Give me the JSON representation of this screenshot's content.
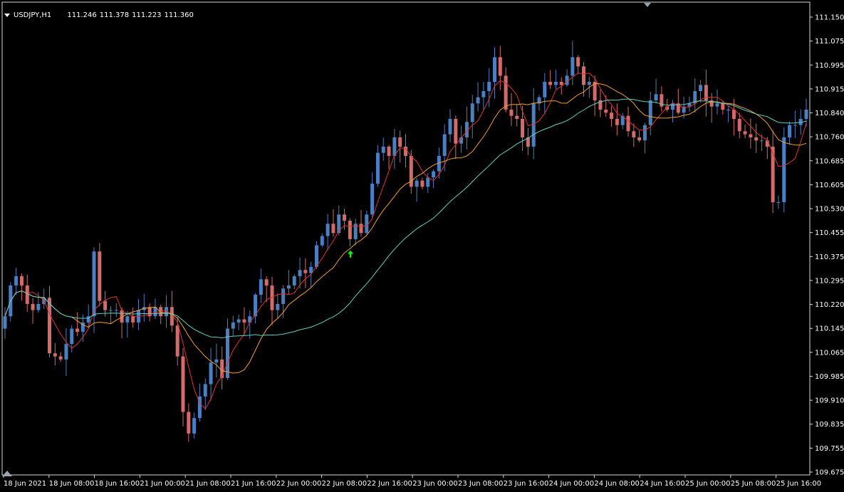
{
  "header": {
    "symbol": "USDJPY,H1",
    "open": "111.246",
    "high": "111.378",
    "low": "111.223",
    "close": "111.360"
  },
  "chart_data": {
    "type": "candlestick",
    "symbol": "USDJPY",
    "timeframe": "H1",
    "ylim": [
      109.675,
      111.2
    ],
    "y_ticks": [
      "111.150",
      "111.075",
      "110.995",
      "110.915",
      "110.840",
      "110.760",
      "110.685",
      "110.605",
      "110.530",
      "110.455",
      "110.375",
      "110.295",
      "110.220",
      "110.145",
      "110.065",
      "109.985",
      "109.910",
      "109.835",
      "109.755",
      "109.675"
    ],
    "x_ticks": [
      "18 Jun 2021",
      "18 Jun 08:00",
      "18 Jun 16:00",
      "21 Jun 00:00",
      "21 Jun 08:00",
      "21 Jun 16:00",
      "22 Jun 00:00",
      "22 Jun 08:00",
      "22 Jun 16:00",
      "23 Jun 00:00",
      "23 Jun 08:00",
      "23 Jun 16:00",
      "24 Jun 00:00",
      "24 Jun 08:00",
      "24 Jun 16:00",
      "25 Jun 00:00",
      "25 Jun 08:00",
      "25 Jun 16:00"
    ],
    "bull_color": "#4a7fc1",
    "bear_color": "#d46a6a",
    "candle_closes": [
      110.18,
      110.28,
      110.31,
      110.28,
      110.22,
      110.2,
      110.22,
      110.24,
      110.06,
      110.05,
      110.04,
      110.09,
      110.14,
      110.13,
      110.16,
      110.18,
      110.39,
      110.23,
      110.2,
      110.2,
      110.2,
      110.16,
      110.18,
      110.16,
      110.2,
      110.21,
      110.18,
      110.21,
      110.18,
      110.21,
      110.15,
      110.05,
      109.87,
      109.8,
      109.85,
      109.92,
      109.96,
      110.03,
      110.04,
      109.98,
      110.14,
      110.16,
      110.17,
      110.16,
      110.18,
      110.25,
      110.3,
      110.28,
      110.2,
      110.22,
      110.27,
      110.28,
      110.31,
      110.33,
      110.32,
      110.34,
      110.41,
      110.44,
      110.48,
      110.45,
      110.51,
      110.49,
      110.43,
      110.48,
      110.45,
      110.51,
      110.61,
      110.71,
      110.73,
      110.7,
      110.76,
      110.73,
      110.7,
      110.6,
      110.62,
      110.6,
      110.63,
      110.65,
      110.7,
      110.77,
      110.82,
      110.74,
      110.76,
      110.81,
      110.87,
      110.89,
      110.91,
      110.94,
      111.02,
      110.96,
      110.85,
      110.83,
      110.82,
      110.76,
      110.73,
      110.87,
      110.89,
      110.94,
      110.93,
      110.94,
      110.93,
      110.96,
      111.02,
      110.99,
      110.93,
      110.94,
      110.88,
      110.85,
      110.84,
      110.82,
      110.8,
      110.83,
      110.78,
      110.76,
      110.75,
      110.8,
      110.88,
      110.9,
      110.86,
      110.85,
      110.87,
      110.84,
      110.86,
      110.87,
      110.91,
      110.93,
      110.88,
      110.86,
      110.87,
      110.85,
      110.85,
      110.82,
      110.78,
      110.77,
      110.76,
      110.75,
      110.75,
      110.73,
      110.55,
      110.55,
      110.76,
      110.8,
      110.8,
      110.82,
      110.85
    ],
    "indicators": [
      {
        "type": "moving-average",
        "color": "#e03030"
      },
      {
        "type": "moving-average",
        "color": "#f0a030"
      },
      {
        "type": "moving-average",
        "color": "#60d0c0"
      }
    ],
    "signals": [
      {
        "type": "up-arrow",
        "color": "#00ff00",
        "x": "22 Jun 10:00",
        "y": 110.38
      }
    ]
  }
}
